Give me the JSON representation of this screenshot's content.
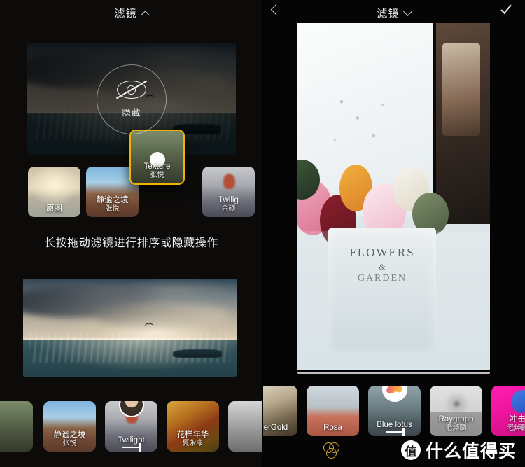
{
  "left_panel": {
    "header": {
      "title": "滤镜",
      "chevron": "chevron-up-icon"
    },
    "hide_zone": {
      "label": "隐藏",
      "icon": "eye-off-icon"
    },
    "hint": "长按拖动滤镜进行排序或隐藏操作",
    "drag_strip": [
      {
        "name": "原图",
        "author": "",
        "art": "art-yuantu"
      },
      {
        "name": "静谧之境",
        "author": "张悦",
        "art": "art-jingmi"
      },
      {
        "name": "Texture",
        "author": "张悦",
        "art": "art-texture",
        "dragging": true
      },
      {
        "name": "Twilig",
        "author": "余硕",
        "art": "art-twilight"
      }
    ],
    "bottom_strip": [
      {
        "name": "",
        "author": "",
        "art": "art-texture"
      },
      {
        "name": "静谧之境",
        "author": "张悦",
        "art": "art-jingmi"
      },
      {
        "name": "Twilight",
        "author": "一卜",
        "art": "art-twilight",
        "avatar": "portrait-avatar",
        "dash": true
      },
      {
        "name": "花样年华",
        "author": "夏永康",
        "art": "art-huayang"
      },
      {
        "name": "",
        "author": "",
        "art": "art-grey"
      }
    ]
  },
  "right_panel": {
    "header": {
      "title": "滤镜",
      "chevron": "chevron-down-icon",
      "back": "back-chevron-icon",
      "confirm": "check-icon"
    },
    "photo": {
      "pot_line1": "FLOWERS",
      "pot_line2": "&",
      "pot_line3": "GARDEN"
    },
    "filters": [
      {
        "name": "uperGold",
        "author": "",
        "art": "art-supergold"
      },
      {
        "name": "Rosa",
        "author": "",
        "art": "art-rosa"
      },
      {
        "name": "Blue lotus",
        "author": "一卜",
        "art": "art-bluelotus",
        "avatar": "lotus-avatar",
        "dash": true,
        "selected": true
      },
      {
        "name": "Raygraph",
        "author": "老焯麟",
        "art": "art-raygraph"
      },
      {
        "name": "冲击",
        "author": "老焯麟",
        "art": "art-chongji"
      }
    ],
    "bottom_bar": {
      "filter_icon": "three-circles-filter-icon"
    }
  },
  "watermark": {
    "logo": "值",
    "text": "什么值得买"
  },
  "colors": {
    "accent_gold": "#f0b400",
    "icon_gold": "#c9a13c",
    "bg": "#000000"
  }
}
